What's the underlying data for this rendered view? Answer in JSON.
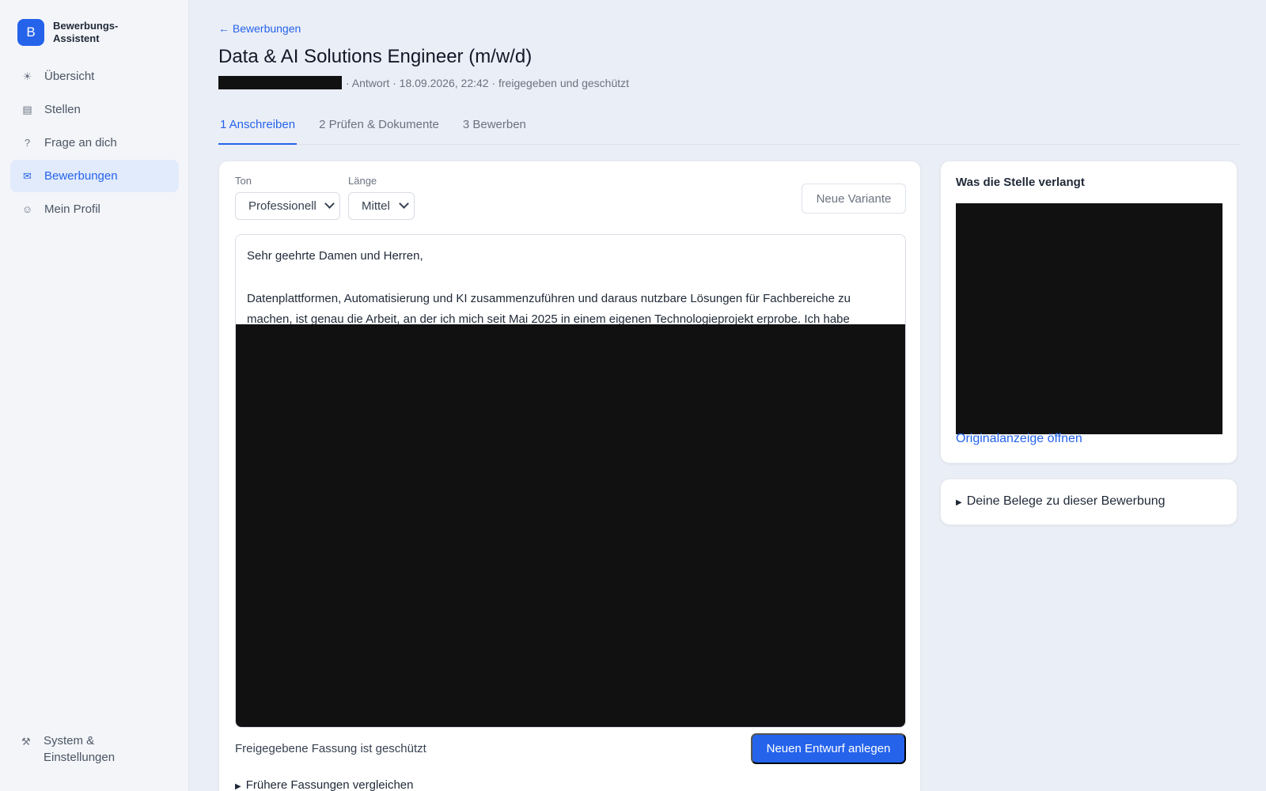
{
  "app": {
    "logo_letter": "B",
    "name": "Bewerbungs-Assistent",
    "accent_color": "#2563eb"
  },
  "sidebar": {
    "items": [
      {
        "icon": "sun-icon",
        "glyph": "☀",
        "label": "Übersicht",
        "active": false
      },
      {
        "icon": "list-icon",
        "glyph": "▤",
        "label": "Stellen",
        "active": false
      },
      {
        "icon": "question-icon",
        "glyph": "?",
        "label": "Frage an dich",
        "active": false
      },
      {
        "icon": "mail-icon",
        "glyph": "✉",
        "label": "Bewerbungen",
        "active": true
      },
      {
        "icon": "smiley-icon",
        "glyph": "☺",
        "label": "Mein Profil",
        "active": false
      }
    ],
    "bottom": {
      "icon": "tools-icon",
      "glyph": "⚒",
      "label": "System & Einstellungen"
    }
  },
  "header": {
    "back_label": "← Bewerbungen",
    "title": "Data & AI Solutions Engineer (m/w/d)",
    "meta": "· Antwort · 18.09.2026, 22:42 · freigegeben und geschützt"
  },
  "tabs": [
    {
      "label": "1 Anschreiben",
      "active": true
    },
    {
      "label": "2 Prüfen & Dokumente",
      "active": false
    },
    {
      "label": "3 Bewerben",
      "active": false
    }
  ],
  "editor": {
    "tone_label": "Ton",
    "tone_value": "Professionell",
    "length_label": "Länge",
    "length_value": "Mittel",
    "new_variant_label": "Neue Variante",
    "greeting": "Sehr geehrte Damen und Herren,",
    "paragraph": "Datenplattformen, Automatisierung und KI zusammenzuführen und daraus nutzbare Lösungen für Fachbereiche zu machen, ist genau die Arbeit, an der ich mich seit Mai 2025 in einem eigenen Technologieprojekt erprobe. Ich habe",
    "locked_text": "Freigegebene Fassung ist geschützt",
    "new_draft_label": "Neuen Entwurf anlegen",
    "compare_label": "Frühere Fassungen vergleichen"
  },
  "requirements": {
    "title": "Was die Stelle verlangt",
    "open_link": "Originalanzeige öffnen"
  },
  "proofs": {
    "summary": "Deine Belege zu dieser Bewerbung"
  }
}
